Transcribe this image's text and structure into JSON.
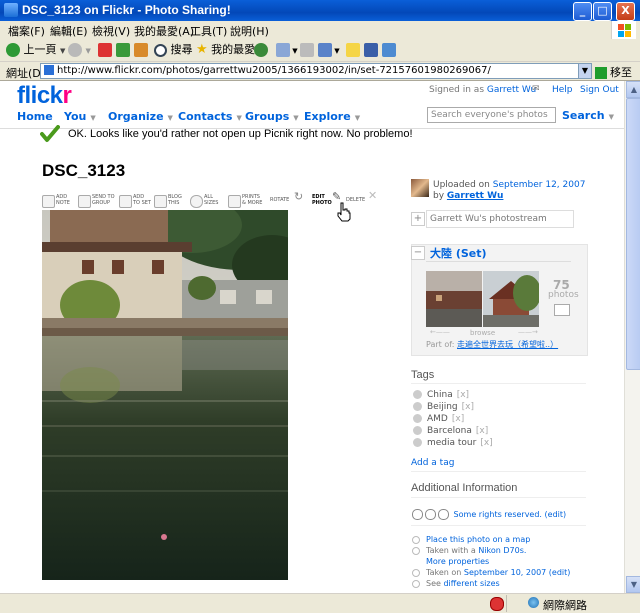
{
  "window": {
    "title": "DSC_3123 on Flickr - Photo Sharing!",
    "min_label": "_",
    "max_label": "□",
    "close_label": "X"
  },
  "menubar": [
    "檔案(F)",
    "編輯(E)",
    "檢視(V)",
    "我的最愛(A)",
    "工具(T)",
    "說明(H)"
  ],
  "toolbar": {
    "back_label": "上一頁",
    "search_label": "搜尋",
    "favorites_label": "我的最愛"
  },
  "address": {
    "label": "網址(D)",
    "url": "http://www.flickr.com/photos/garrettwu2005/1366193002/in/set-72157601980269067/",
    "go_label": "移至"
  },
  "status": {
    "zone": "網際網路"
  },
  "flickr": {
    "logo_a": "flick",
    "logo_b": "r",
    "signed_in_prefix": "Signed in as",
    "user": "Garrett Wu",
    "help": "Help",
    "sign_out": "Sign Out",
    "nav": [
      "Home",
      "You",
      "Organize",
      "Contacts",
      "Groups",
      "Explore"
    ],
    "search_placeholder": "Search everyone's photos",
    "search_button": "Search",
    "notice": "OK. Looks like you'd rather not open up Picnik right now. No problemo!"
  },
  "photo": {
    "title": "DSC_3123",
    "tools": [
      {
        "l1": "ADD",
        "l2": "NOTE"
      },
      {
        "l1": "SEND TO",
        "l2": "GROUP"
      },
      {
        "l1": "ADD",
        "l2": "TO SET"
      },
      {
        "l1": "BLOG",
        "l2": "THIS"
      },
      {
        "l1": "ALL",
        "l2": "SIZES"
      },
      {
        "l1": "PRINTS",
        "l2": "& MORE"
      },
      {
        "l1": "ROTATE",
        "l2": ""
      },
      {
        "l1": "EDIT",
        "l2": "PHOTO"
      },
      {
        "l1": "DELETE",
        "l2": ""
      }
    ]
  },
  "sidebar": {
    "uploaded_prefix": "Uploaded on",
    "uploaded_date": "September 12, 2007",
    "by_prefix": "by",
    "by_user": "Garrett Wu",
    "photostream": "Garrett Wu's photostream",
    "set_name": "大陸 (Set)",
    "set_count": "75",
    "set_count_label": "photos",
    "browse": "browse",
    "part_of_prefix": "Part of:",
    "part_of": "走遍全世界去玩（希望啦..）",
    "tags_heading": "Tags",
    "tags": [
      "China",
      "Beijing",
      "AMD",
      "Barcelona",
      "media tour"
    ],
    "tag_remove": "[x]",
    "add_tag": "Add a tag",
    "additional_heading": "Additional Information",
    "rights": "Some rights reserved.",
    "edit": "(edit)",
    "place_on_map": "Place this photo on a map",
    "taken_with_prefix": "Taken with a",
    "camera": "Nikon D70s.",
    "more_properties": "More properties",
    "taken_on_prefix": "Taken on",
    "taken_on": "September 10, 2007",
    "see_prefix": "See",
    "different_sizes": "different sizes"
  }
}
